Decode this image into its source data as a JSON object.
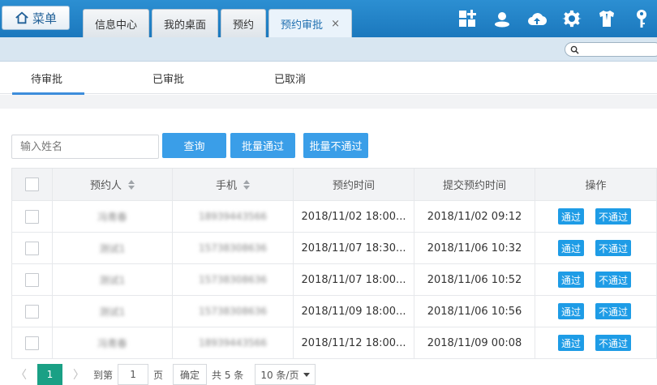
{
  "topbar": {
    "menu_label": "菜单",
    "tabs": [
      {
        "label": "信息中心"
      },
      {
        "label": "我的桌面"
      },
      {
        "label": "预约"
      },
      {
        "label": "预约审批",
        "close": "×"
      }
    ]
  },
  "subtabs": [
    "待审批",
    "已审批",
    "已取消"
  ],
  "toolbar": {
    "name_placeholder": "输入姓名",
    "query_label": "查询",
    "batch_pass_label": "批量通过",
    "batch_reject_label": "批量不通过"
  },
  "table": {
    "headers": [
      "预约人",
      "手机",
      "预约时间",
      "提交预约时间",
      "操作"
    ],
    "rows": [
      {
        "name": "冯青春",
        "phone": "18939443566",
        "appt": "2018/11/02 18:00...",
        "submitted": "2018/11/02 09:12"
      },
      {
        "name": "测试1",
        "phone": "15738308636",
        "appt": "2018/11/07 18:30...",
        "submitted": "2018/11/06 10:32"
      },
      {
        "name": "测试1",
        "phone": "15738308636",
        "appt": "2018/11/07 18:00...",
        "submitted": "2018/11/06 10:52"
      },
      {
        "name": "测试1",
        "phone": "15738308636",
        "appt": "2018/11/09 18:00...",
        "submitted": "2018/11/06 10:56"
      },
      {
        "name": "冯青春",
        "phone": "18939443566",
        "appt": "2018/11/12 18:00...",
        "submitted": "2018/11/09 00:08"
      }
    ],
    "action_pass": "通过",
    "action_reject": "不通过"
  },
  "pager": {
    "prev": "〈",
    "current": "1",
    "next": "〉",
    "goto_label": "到第",
    "page_input": "1",
    "page_unit": "页",
    "confirm": "确定",
    "total": "共 5 条",
    "page_size": "10 条/页"
  }
}
